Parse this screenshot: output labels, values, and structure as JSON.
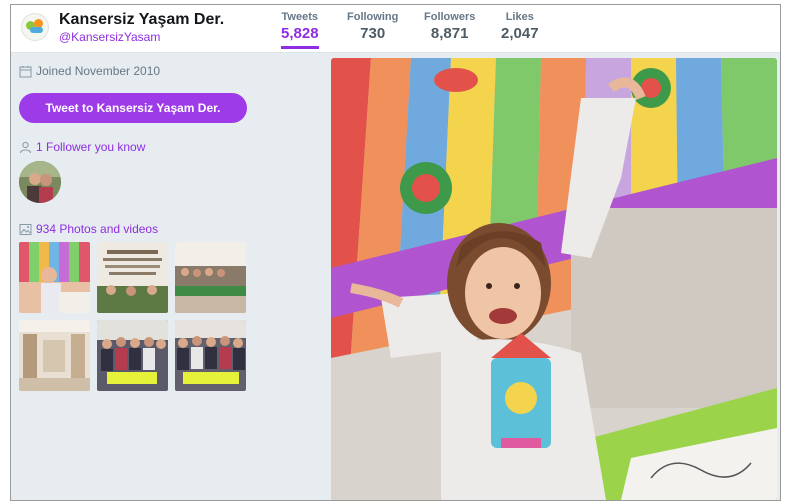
{
  "profile": {
    "name": "Kansersiz Yaşam Der.",
    "handle": "@KansersizYasam"
  },
  "stats": [
    {
      "label": "Tweets",
      "value": "5,828"
    },
    {
      "label": "Following",
      "value": "730"
    },
    {
      "label": "Followers",
      "value": "8,871"
    },
    {
      "label": "Likes",
      "value": "2,047"
    }
  ],
  "sidebar": {
    "joined": "Joined November 2010",
    "tweet_button": "Tweet to Kansersiz Yaşam Der.",
    "followers_you_know": "1 Follower you know",
    "photos_videos": "934 Photos and videos"
  },
  "icons": {
    "calendar": "calendar-icon",
    "person": "person-icon",
    "photo": "photo-icon"
  },
  "colors": {
    "accent": "#9d3be8",
    "accent_text": "#8e2ee0",
    "background": "#e6ecf0"
  }
}
